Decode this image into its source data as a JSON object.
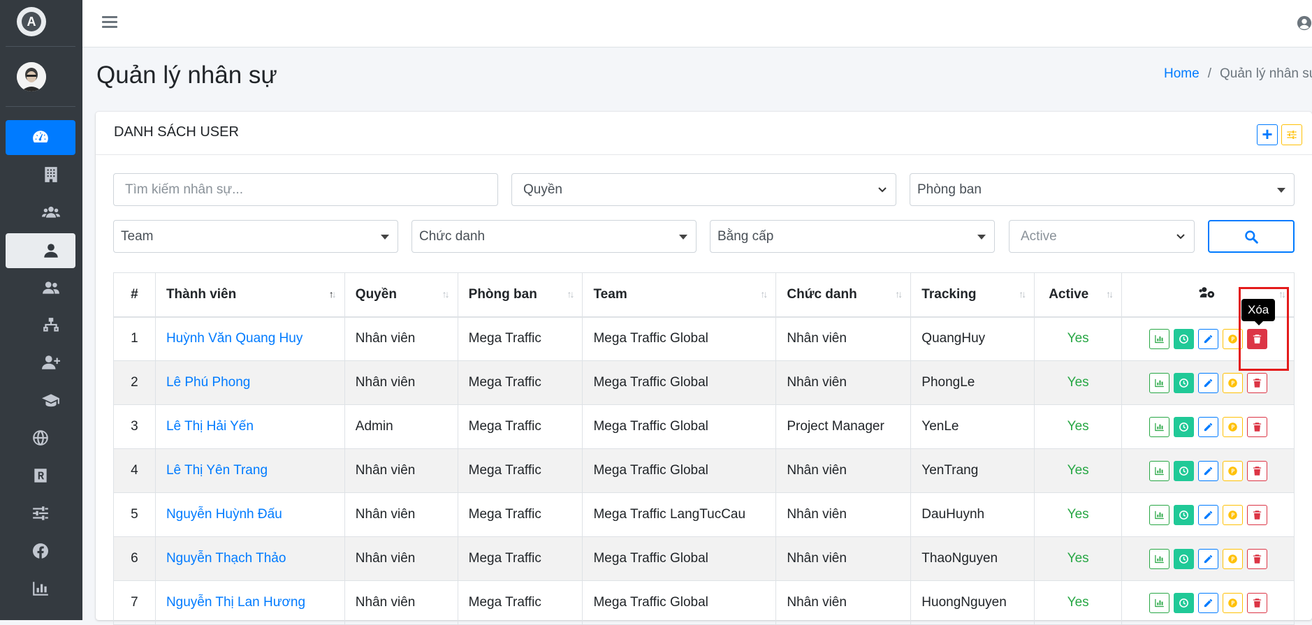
{
  "page": {
    "title": "Quản lý nhân sự",
    "breadcrumb": {
      "home": "Home",
      "separator": "/",
      "current": "Quản lý nhân sự"
    }
  },
  "brand": {
    "logo_letter": "A",
    "logo_icon": "brand-logo-icon"
  },
  "sidebar": {
    "items": [
      {
        "icon": "dashboard-icon",
        "state": "active"
      },
      {
        "icon": "building-icon",
        "state": "normal"
      },
      {
        "icon": "users-icon",
        "state": "normal"
      },
      {
        "icon": "user-icon",
        "state": "selected"
      },
      {
        "icon": "user-group-icon",
        "state": "normal"
      },
      {
        "icon": "sitemap-icon",
        "state": "normal"
      },
      {
        "icon": "user-plus-icon",
        "state": "normal"
      },
      {
        "icon": "graduation-cap-icon",
        "state": "normal"
      },
      {
        "icon": "globe-icon",
        "state": "normal"
      },
      {
        "icon": "registered-icon",
        "state": "normal"
      },
      {
        "icon": "sliders-icon",
        "state": "normal"
      },
      {
        "icon": "facebook-icon",
        "state": "normal"
      },
      {
        "icon": "bar-chart-icon",
        "state": "normal"
      }
    ]
  },
  "card": {
    "title": "DANH SÁCH USER",
    "add_button_icon": "plus-icon",
    "settings_button_icon": "sliders-icon"
  },
  "filters": {
    "search_placeholder": "Tìm kiếm nhân sự...",
    "role": "Quyền",
    "department": "Phòng ban",
    "team": "Team",
    "title": "Chức danh",
    "degree": "Bằng cấp",
    "active": "Active",
    "search_button_icon": "search-icon"
  },
  "table": {
    "columns": [
      "#",
      "Thành viên",
      "Quyền",
      "Phòng ban",
      "Team",
      "Chức danh",
      "Tracking",
      "Active"
    ],
    "action_column_icon": "users-cog-icon",
    "rows": [
      {
        "num": "1",
        "name": "Huỳnh Văn Quang Huy",
        "role": "Nhân viên",
        "dept": "Mega Traffic",
        "team": "Mega Traffic Global",
        "title": "Nhân viên",
        "tracking": "QuangHuy",
        "active": "Yes"
      },
      {
        "num": "2",
        "name": "Lê Phú Phong",
        "role": "Nhân viên",
        "dept": "Mega Traffic",
        "team": "Mega Traffic Global",
        "title": "Nhân viên",
        "tracking": "PhongLe",
        "active": "Yes"
      },
      {
        "num": "3",
        "name": "Lê Thị Hải Yến",
        "role": "Admin",
        "dept": "Mega Traffic",
        "team": "Mega Traffic Global",
        "title": "Project Manager",
        "tracking": "YenLe",
        "active": "Yes"
      },
      {
        "num": "4",
        "name": "Lê Thị Yên Trang",
        "role": "Nhân viên",
        "dept": "Mega Traffic",
        "team": "Mega Traffic Global",
        "title": "Nhân viên",
        "tracking": "YenTrang",
        "active": "Yes"
      },
      {
        "num": "5",
        "name": "Nguyễn Huỳnh Đấu",
        "role": "Nhân viên",
        "dept": "Mega Traffic",
        "team": "Mega Traffic LangTucCau",
        "title": "Nhân viên",
        "tracking": "DauHuynh",
        "active": "Yes"
      },
      {
        "num": "6",
        "name": "Nguyễn Thạch Thảo",
        "role": "Nhân viên",
        "dept": "Mega Traffic",
        "team": "Mega Traffic Global",
        "title": "Nhân viên",
        "tracking": "ThaoNguyen",
        "active": "Yes"
      },
      {
        "num": "7",
        "name": "Nguyễn Thị Lan Hương",
        "role": "Nhân viên",
        "dept": "Mega Traffic",
        "team": "Mega Traffic Global",
        "title": "Nhân viên",
        "tracking": "HuongNguyen",
        "active": "Yes"
      }
    ],
    "row_actions": [
      "chart-icon",
      "clock-icon",
      "pencil-icon",
      "coin-icon",
      "trash-icon"
    ]
  },
  "tooltip": {
    "text": "Xóa"
  },
  "colors": {
    "sidebar_bg": "#343a40",
    "primary": "#007bff",
    "success": "#28a745",
    "teal": "#20c997",
    "warning": "#ffc107",
    "danger": "#dc3545",
    "highlight_box": "#e41b1b"
  }
}
